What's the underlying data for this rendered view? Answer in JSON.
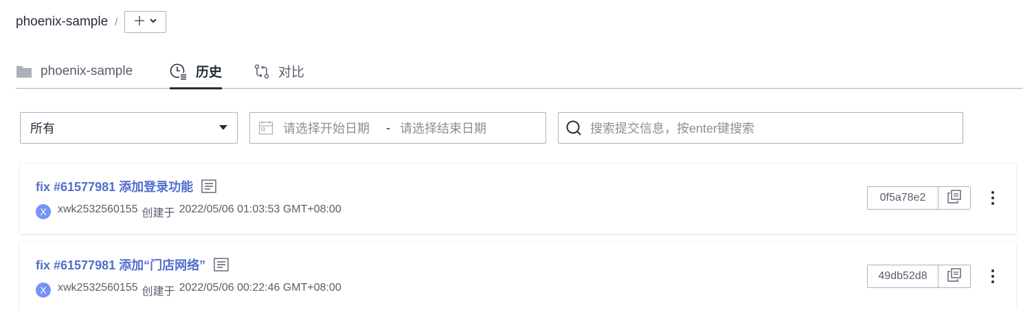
{
  "breadcrumb": {
    "repo": "phoenix-sample",
    "separator": "/"
  },
  "tabs": [
    {
      "label": "phoenix-sample",
      "icon": "folder-icon",
      "active": false
    },
    {
      "label": "历史",
      "icon": "history-clock-icon",
      "active": true
    },
    {
      "label": "对比",
      "icon": "compare-icon",
      "active": false
    }
  ],
  "filters": {
    "branch_select": "所有",
    "start_date_placeholder": "请选择开始日期",
    "date_separator": "-",
    "end_date_placeholder": "请选择结束日期",
    "search_placeholder": "搜索提交信息，按enter键搜索"
  },
  "commits": [
    {
      "title": "fix #61577981 添加登录功能",
      "avatar_letter": "X",
      "author": "xwk2532560155",
      "action": "创建于",
      "time": "2022/05/06 01:03:53 GMT+08:00",
      "sha": "0f5a78e2"
    },
    {
      "title": "fix #61577981 添加“门店网络”",
      "avatar_letter": "X",
      "author": "xwk2532560155",
      "action": "创建于",
      "time": "2022/05/06 00:22:46 GMT+08:00",
      "sha": "49db52d8"
    }
  ],
  "colors": {
    "link": "#526ecc",
    "avatar": "#7693f5",
    "border": "#adb0b8",
    "text": "#252b3a",
    "muted": "#8a8e99"
  }
}
